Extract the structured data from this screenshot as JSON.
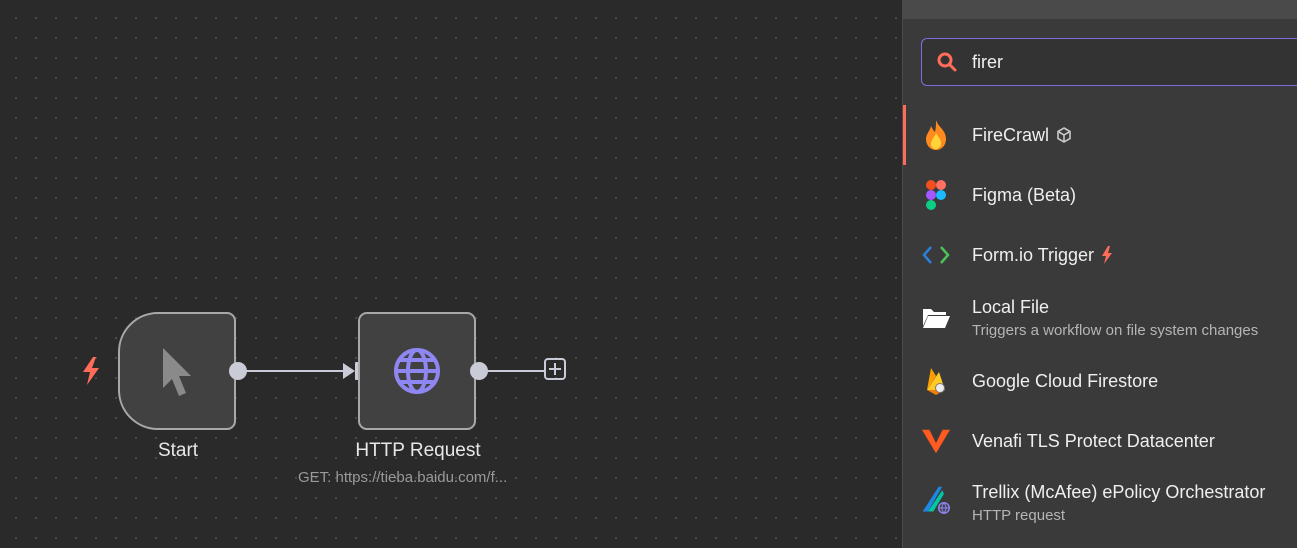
{
  "canvas": {
    "nodes": [
      {
        "label": "Start",
        "icon": "cursor-arrow-icon"
      },
      {
        "label": "HTTP Request",
        "subtitle": "GET: https://tieba.baidu.com/f...",
        "icon": "globe-icon"
      }
    ]
  },
  "panel": {
    "search": {
      "value": "firer",
      "icon": "search-icon"
    },
    "results": [
      {
        "name": "FireCrawl",
        "icon": "flame-icon",
        "badge": "package-icon",
        "active": true
      },
      {
        "name": "Figma (Beta)",
        "icon": "figma-icon"
      },
      {
        "name": "Form.io Trigger",
        "icon": "code-brackets-icon",
        "badge": "bolt-icon"
      },
      {
        "name": "Local File",
        "description": "Triggers a workflow on file system changes",
        "icon": "folder-open-icon"
      },
      {
        "name": "Google Cloud Firestore",
        "icon": "firestore-icon"
      },
      {
        "name": "Venafi TLS Protect Datacenter",
        "icon": "venafi-icon"
      },
      {
        "name": "Trellix (McAfee) ePolicy Orchestrator",
        "description": "HTTP request",
        "icon": "trellix-icon"
      }
    ]
  },
  "colors": {
    "accent": "#ff6d5a",
    "focus": "#7b6fe0",
    "node_icon": "#8f87f1"
  }
}
